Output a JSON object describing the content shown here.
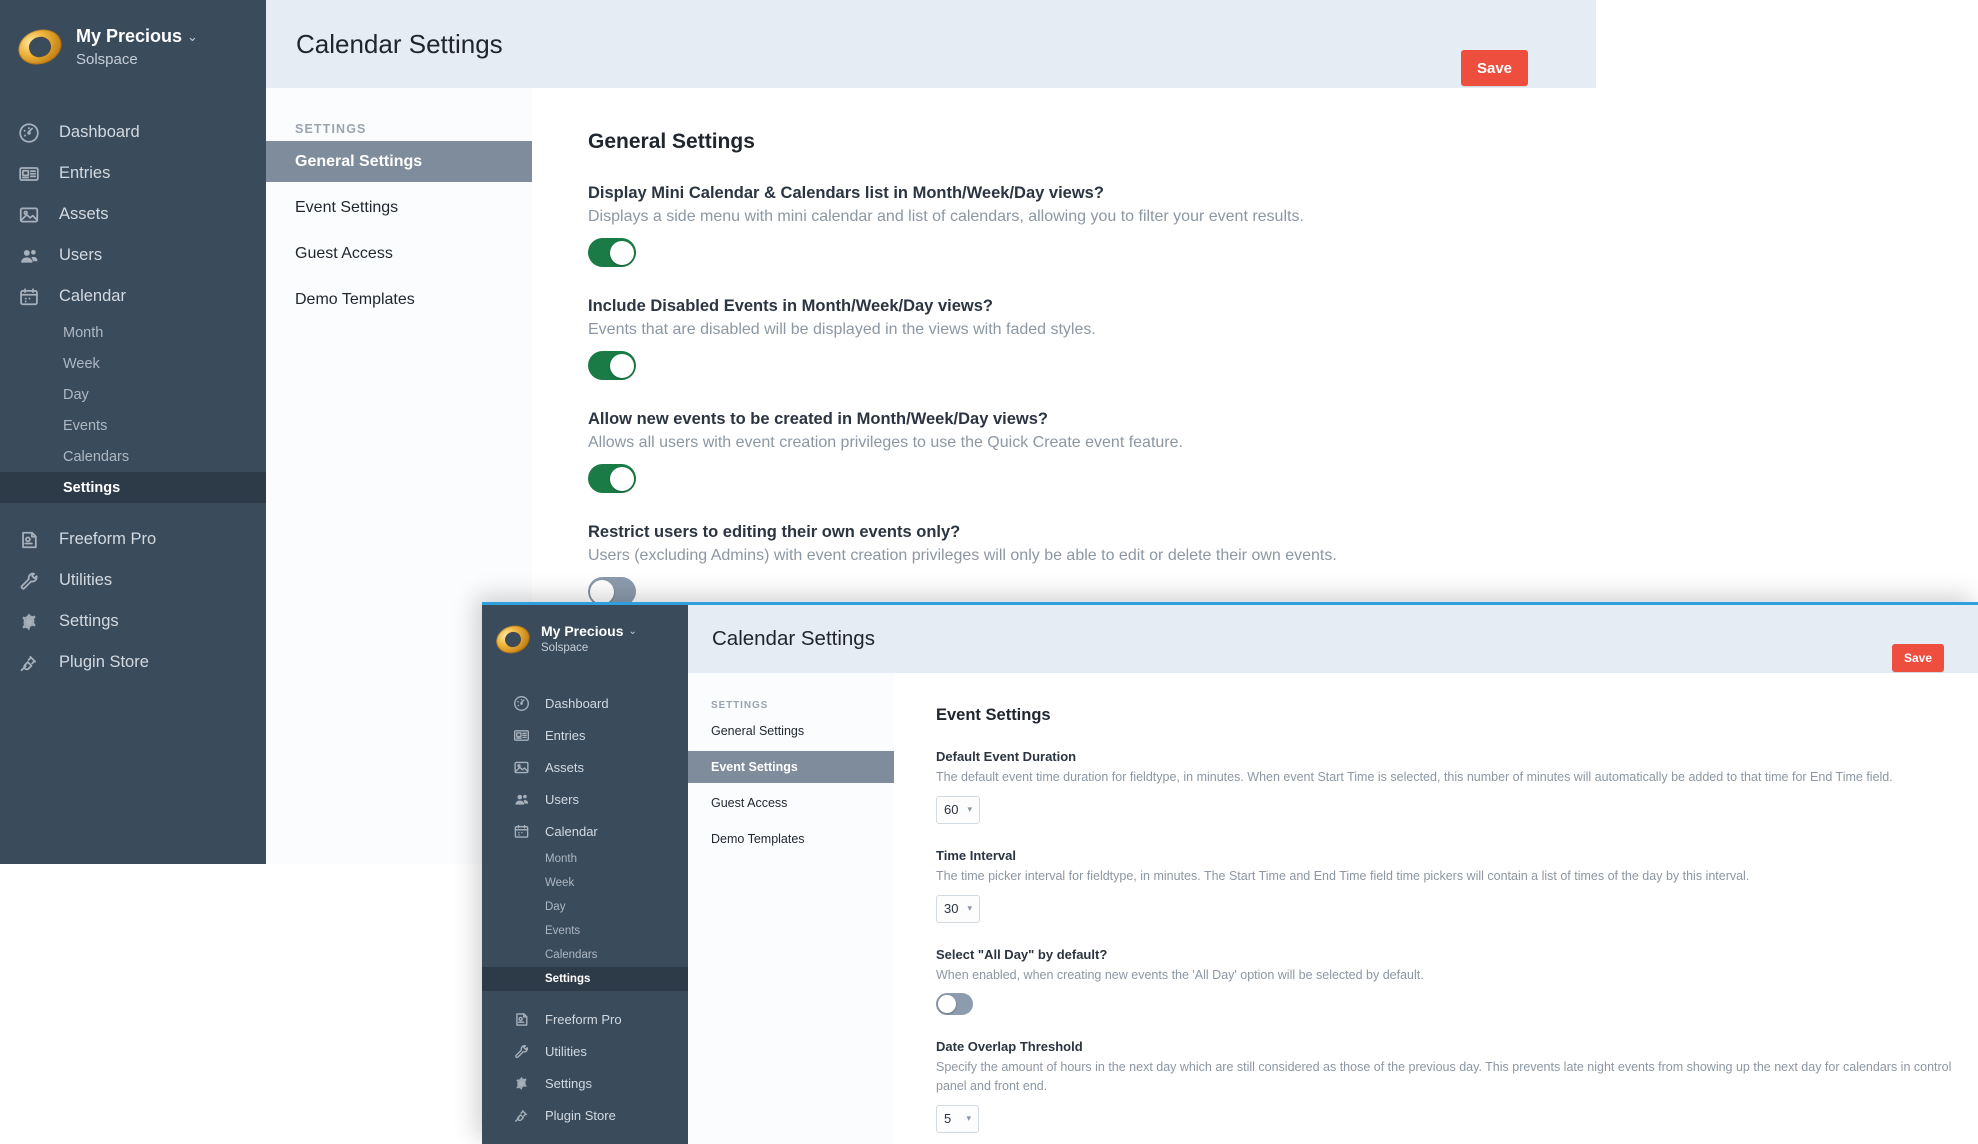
{
  "brand": {
    "name": "My Precious",
    "sub": "Solspace",
    "chevron": "⌄",
    "logo_icon": "ring-icon",
    "accent": "#ee4e3e"
  },
  "nav": [
    {
      "label": "Dashboard",
      "icon": "dashboard-icon",
      "type": "top"
    },
    {
      "label": "Entries",
      "icon": "entries-icon",
      "type": "top"
    },
    {
      "label": "Assets",
      "icon": "assets-icon",
      "type": "top"
    },
    {
      "label": "Users",
      "icon": "users-icon",
      "type": "top"
    },
    {
      "label": "Calendar",
      "icon": "calendar-icon",
      "type": "top"
    },
    {
      "label": "Month",
      "type": "sub"
    },
    {
      "label": "Week",
      "type": "sub"
    },
    {
      "label": "Day",
      "type": "sub"
    },
    {
      "label": "Events",
      "type": "sub"
    },
    {
      "label": "Calendars",
      "type": "sub"
    },
    {
      "label": "Settings",
      "type": "sub",
      "active": true
    },
    {
      "label": "Freeform Pro",
      "icon": "freeform-icon",
      "type": "top",
      "gap": true
    },
    {
      "label": "Utilities",
      "icon": "wrench-icon",
      "type": "top"
    },
    {
      "label": "Settings",
      "icon": "gear-icon",
      "type": "top"
    },
    {
      "label": "Plugin Store",
      "icon": "plug-icon",
      "type": "top"
    }
  ],
  "header": {
    "title": "Calendar Settings",
    "save_label": "Save"
  },
  "setnav": {
    "heading": "SETTINGS",
    "items": [
      {
        "label": "General Settings"
      },
      {
        "label": "Event Settings"
      },
      {
        "label": "Guest Access"
      },
      {
        "label": "Demo Templates"
      }
    ]
  },
  "window1": {
    "selected_setnav": "General Settings",
    "section_title": "General Settings",
    "fields": [
      {
        "label": "Display Mini Calendar & Calendars list in Month/Week/Day views?",
        "instructions": "Displays a side menu with mini calendar and list of calendars, allowing you to filter your event results.",
        "control": "toggle",
        "value": "on"
      },
      {
        "label": "Include Disabled Events in Month/Week/Day views?",
        "instructions": "Events that are disabled will be displayed in the views with faded styles.",
        "control": "toggle",
        "value": "on"
      },
      {
        "label": "Allow new events to be created in Month/Week/Day views?",
        "instructions": "Allows all users with event creation privileges to use the Quick Create event feature.",
        "control": "toggle",
        "value": "on"
      },
      {
        "label": "Restrict users to editing their own events only?",
        "instructions": "Users (excluding Admins) with event creation privileges will only be able to edit or delete their own events.",
        "control": "toggle",
        "value": "off"
      }
    ]
  },
  "window2": {
    "selected_setnav": "Event Settings",
    "section_title": "Event Settings",
    "fields": [
      {
        "label": "Default Event Duration",
        "instructions": "The default event time duration for fieldtype, in minutes. When event Start Time is selected, this number of minutes will automatically be added to that time for End Time field.",
        "control": "select",
        "value": "60"
      },
      {
        "label": "Time Interval",
        "instructions": "The time picker interval for fieldtype, in minutes. The Start Time and End Time field time pickers will contain a list of times of the day by this interval.",
        "control": "select",
        "value": "30"
      },
      {
        "label": "Select \"All Day\" by default?",
        "instructions": "When enabled, when creating new events the 'All Day' option will be selected by default.",
        "control": "toggle",
        "value": "off"
      },
      {
        "label": "Date Overlap Threshold",
        "instructions": "Specify the amount of hours in the next day which are still considered as those of the previous day. This prevents late night events from showing up the next day for calendars in control panel and front end.",
        "control": "select",
        "value": "5"
      }
    ]
  }
}
